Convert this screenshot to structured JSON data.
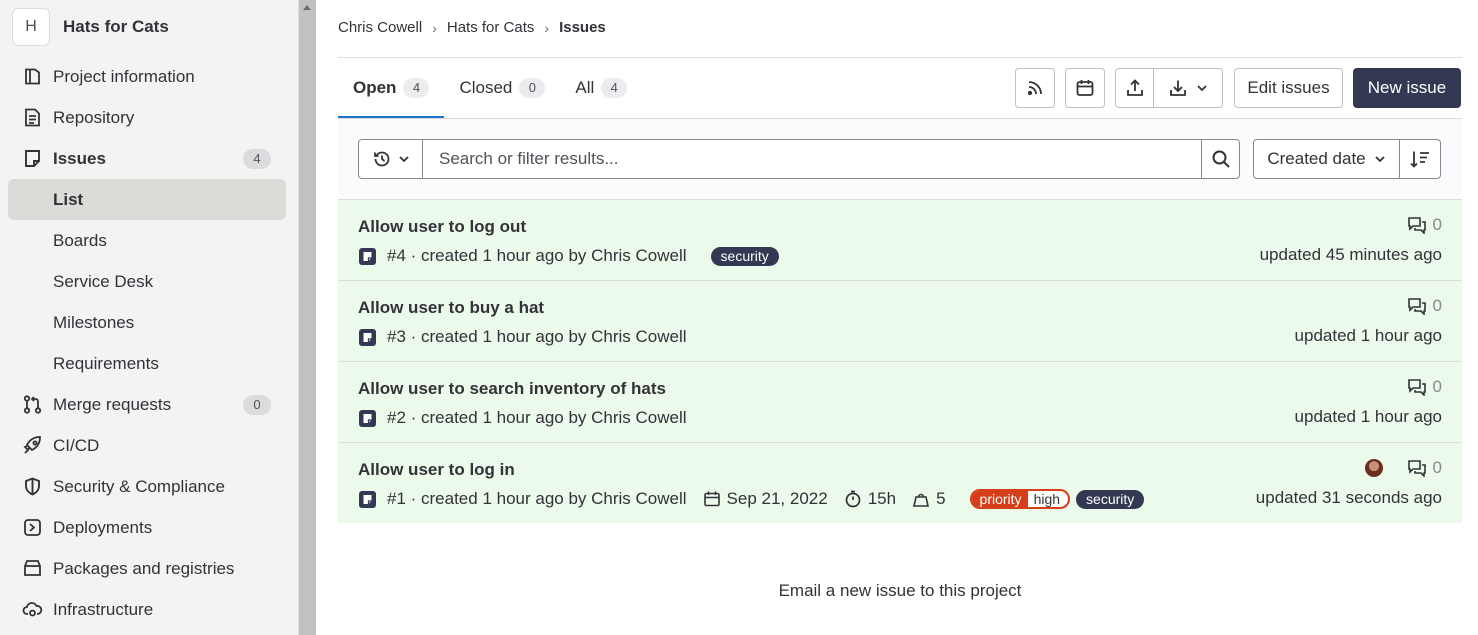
{
  "project": {
    "avatar_letter": "H",
    "name": "Hats for Cats"
  },
  "sidebar": {
    "items": [
      {
        "label": "Project information",
        "icon": "project-info-icon"
      },
      {
        "label": "Repository",
        "icon": "repository-icon"
      },
      {
        "label": "Issues",
        "icon": "issues-icon",
        "count": "4"
      },
      {
        "label": "List"
      },
      {
        "label": "Boards"
      },
      {
        "label": "Service Desk"
      },
      {
        "label": "Milestones"
      },
      {
        "label": "Requirements"
      },
      {
        "label": "Merge requests",
        "icon": "merge-request-icon",
        "count": "0"
      },
      {
        "label": "CI/CD",
        "icon": "rocket-icon"
      },
      {
        "label": "Security & Compliance",
        "icon": "shield-icon"
      },
      {
        "label": "Deployments",
        "icon": "deployments-icon"
      },
      {
        "label": "Packages and registries",
        "icon": "package-icon"
      },
      {
        "label": "Infrastructure",
        "icon": "cloud-gear-icon"
      }
    ]
  },
  "breadcrumb": [
    "Chris Cowell",
    "Hats for Cats",
    "Issues"
  ],
  "tabs": [
    {
      "label": "Open",
      "count": "4"
    },
    {
      "label": "Closed",
      "count": "0"
    },
    {
      "label": "All",
      "count": "4"
    }
  ],
  "toolbar": {
    "edit_label": "Edit issues",
    "new_label": "New issue",
    "icons": [
      "rss-icon",
      "calendar-icon",
      "export-icon",
      "import-icon"
    ]
  },
  "filter": {
    "placeholder": "Search or filter results...",
    "sort_label": "Created date"
  },
  "issues": [
    {
      "title": "Allow user to log out",
      "meta": "#4 · created 1 hour ago by Chris Cowell",
      "labels": [
        "security"
      ],
      "comments": "0",
      "updated": "updated 45 minutes ago"
    },
    {
      "title": "Allow user to buy a hat",
      "meta": "#3 · created 1 hour ago by Chris Cowell",
      "comments": "0",
      "updated": "updated 1 hour ago"
    },
    {
      "title": "Allow user to search inventory of hats",
      "meta": "#2 · created 1 hour ago by Chris Cowell",
      "comments": "0",
      "updated": "updated 1 hour ago"
    },
    {
      "title": "Allow user to log in",
      "meta": "#1 · created 1 hour ago by Chris Cowell",
      "due_date": "Sep 21, 2022",
      "time_estimate": "15h",
      "weight": "5",
      "scoped_label": {
        "key": "priority",
        "value": "high"
      },
      "labels": [
        "security"
      ],
      "comments": "0",
      "updated": "updated 31 seconds ago"
    }
  ],
  "email_link": "Email a new issue to this project",
  "colors": {
    "issue_bg": "#ecfaeb",
    "primary_button": "#333952",
    "scoped_label": "#d63e1a",
    "tab_active": "#1f75cb"
  }
}
